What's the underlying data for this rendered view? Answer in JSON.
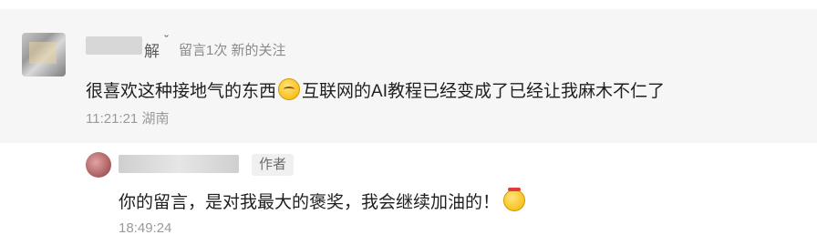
{
  "comment": {
    "username_visible": "解",
    "username_suffix": "ˇ",
    "meta": "留言1次 新的关注",
    "text_before_emoji": "很喜欢这种接地气的东西",
    "emoji": "thinking-emoji",
    "text_after_emoji": "互联网的AI教程已经变成了已经让我麻木不仁了",
    "time": "11:21:21 湖南"
  },
  "reply": {
    "author_badge": "作者",
    "text": "你的留言，是对我最大的褒奖，我会继续加油的！",
    "emoji": "determined-emoji",
    "time": "18:49:24"
  },
  "colors": {
    "comment_bg": "#f6f6f6",
    "text_primary": "#1f1f1f",
    "text_secondary": "#8a8a8a"
  }
}
